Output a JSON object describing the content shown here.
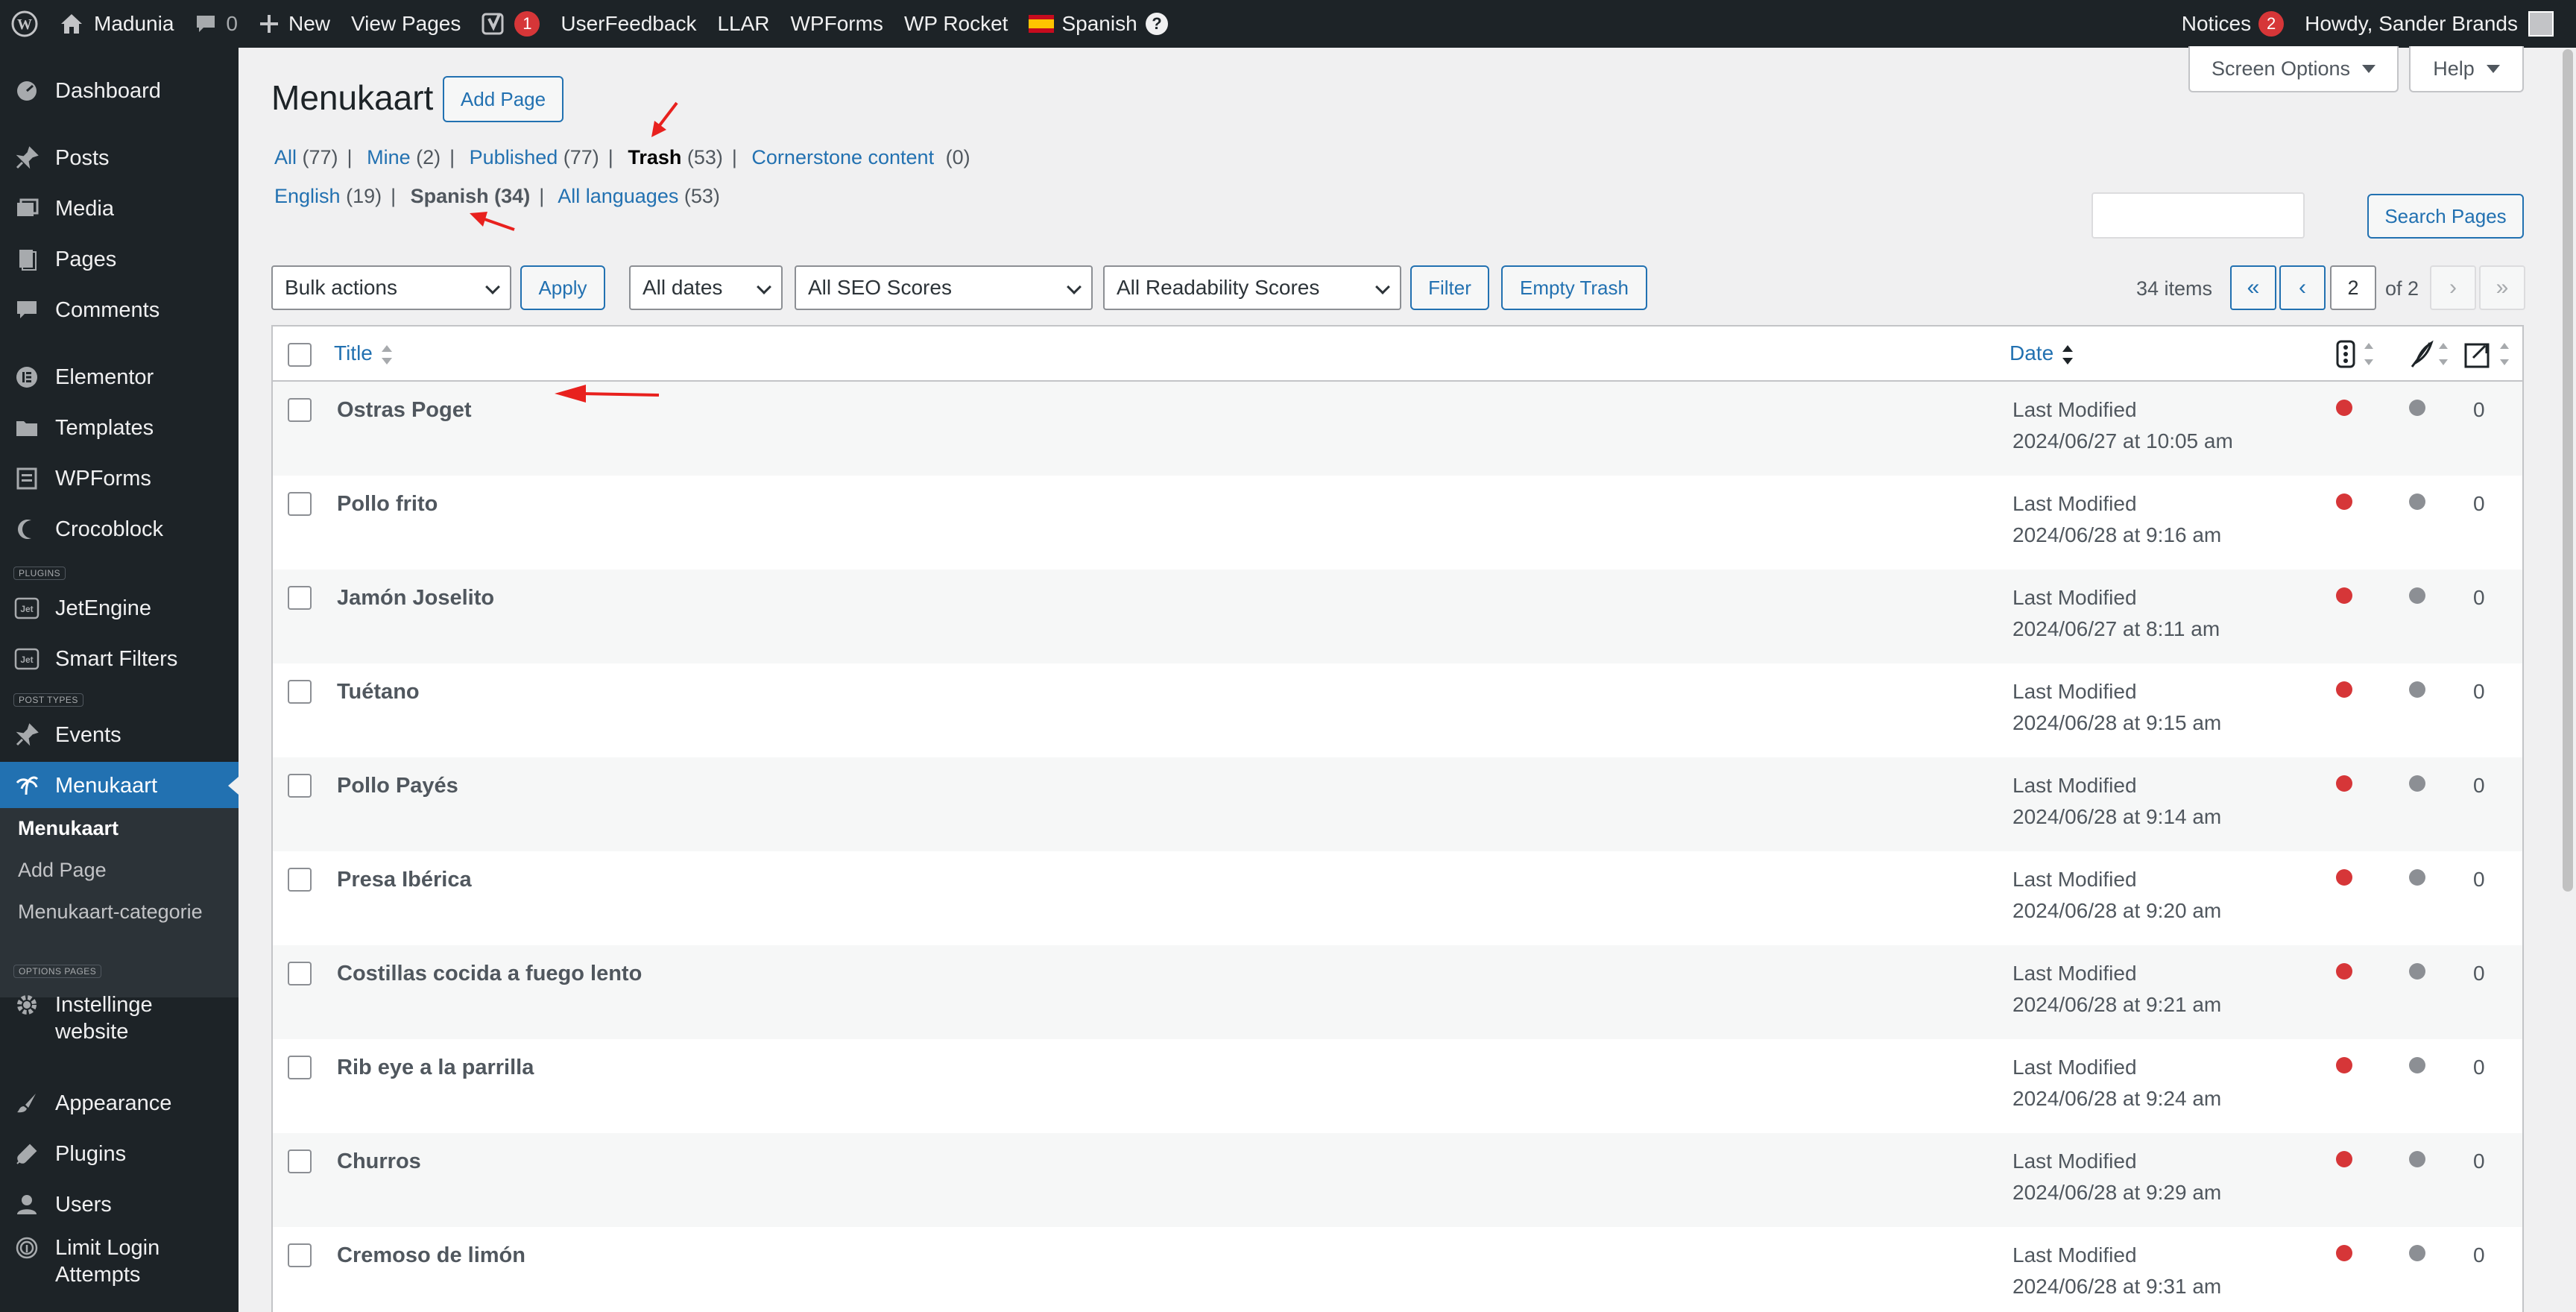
{
  "adminbar": {
    "site_name": "Madunia",
    "comments_count": "0",
    "new_label": "New",
    "view_pages": "View Pages",
    "yoast_count": "1",
    "userfeedback": "UserFeedback",
    "llar": "LLAR",
    "wpforms": "WPForms",
    "wprocket": "WP Rocket",
    "language": "Spanish",
    "notices": "Notices",
    "notices_count": "2",
    "howdy": "Howdy, Sander Brands"
  },
  "sidebar": {
    "dashboard": "Dashboard",
    "posts": "Posts",
    "media": "Media",
    "pages": "Pages",
    "comments": "Comments",
    "elementor": "Elementor",
    "templates": "Templates",
    "wpforms": "WPForms",
    "crocoblock": "Crocoblock",
    "plugins_label": "PLUGINS",
    "jetengine": "JetEngine",
    "smart_filters": "Smart Filters",
    "post_types_label": "POST TYPES",
    "events": "Events",
    "menukaart": "Menukaart",
    "sub_menukaart": "Menukaart",
    "sub_add_page": "Add Page",
    "sub_categorie": "Menukaart-categorie",
    "options_pages_label": "OPTIONS PAGES",
    "instellinge_1": "Instellinge",
    "instellinge_2": "website",
    "appearance": "Appearance",
    "plugins": "Plugins",
    "users": "Users",
    "limit_login_1": "Limit Login",
    "limit_login_2": "Attempts"
  },
  "header": {
    "title": "Menukaart",
    "add_page": "Add Page",
    "screen_options": "Screen Options",
    "help": "Help"
  },
  "status_filters": [
    {
      "label": "All",
      "count": "(77)"
    },
    {
      "label": "Mine",
      "count": "(2)"
    },
    {
      "label": "Published",
      "count": "(77)"
    },
    {
      "label": "Trash",
      "count": "(53)"
    },
    {
      "label": "Cornerstone content",
      "count": "(0)"
    }
  ],
  "language_filters": [
    {
      "label": "English",
      "count": "(19)"
    },
    {
      "label": "Spanish",
      "count": "(34)"
    },
    {
      "label": "All languages",
      "count": "(53)"
    }
  ],
  "search": {
    "button": "Search Pages",
    "value": ""
  },
  "toolbar": {
    "bulk_actions": "Bulk actions",
    "apply": "Apply",
    "dates": "All dates",
    "seo": "All SEO Scores",
    "readability": "All Readability Scores",
    "filter": "Filter",
    "empty_trash": "Empty Trash"
  },
  "pagination": {
    "items": "34 items",
    "first": "«",
    "prev": "‹",
    "current": "2",
    "of": "of 2",
    "next": "›",
    "last": "»"
  },
  "table": {
    "col_title": "Title",
    "col_date": "Date",
    "rows": [
      {
        "title": "Ostras Poget",
        "status": "Last Modified",
        "date": "2024/06/27 at 10:05 am",
        "count": "0"
      },
      {
        "title": "Pollo frito",
        "status": "Last Modified",
        "date": "2024/06/28 at 9:16 am",
        "count": "0"
      },
      {
        "title": "Jamón Joselito",
        "status": "Last Modified",
        "date": "2024/06/27 at 8:11 am",
        "count": "0"
      },
      {
        "title": "Tuétano",
        "status": "Last Modified",
        "date": "2024/06/28 at 9:15 am",
        "count": "0"
      },
      {
        "title": "Pollo Payés",
        "status": "Last Modified",
        "date": "2024/06/28 at 9:14 am",
        "count": "0"
      },
      {
        "title": "Presa Ibérica",
        "status": "Last Modified",
        "date": "2024/06/28 at 9:20 am",
        "count": "0"
      },
      {
        "title": "Costillas cocida a fuego lento",
        "status": "Last Modified",
        "date": "2024/06/28 at 9:21 am",
        "count": "0"
      },
      {
        "title": "Rib eye a la parrilla",
        "status": "Last Modified",
        "date": "2024/06/28 at 9:24 am",
        "count": "0"
      },
      {
        "title": "Churros",
        "status": "Last Modified",
        "date": "2024/06/28 at 9:29 am",
        "count": "0"
      },
      {
        "title": "Cremoso de limón",
        "status": "Last Modified",
        "date": "2024/06/28 at 9:31 am",
        "count": "0"
      }
    ]
  },
  "colors": {
    "seo_dot": "#d63638",
    "readability_dot": "#8c8f94",
    "accent": "#2271b1",
    "annotation_arrow": "#e8211e"
  }
}
